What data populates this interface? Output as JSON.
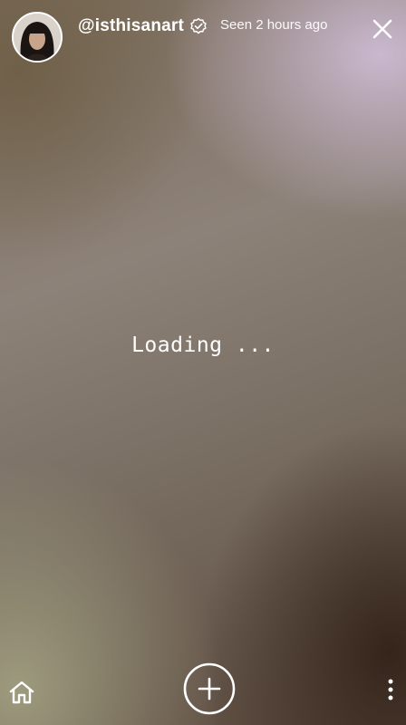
{
  "header": {
    "username": "@isthisanart",
    "verified": true,
    "seen_text": "Seen 2 hours ago",
    "avatar_icon": "user-avatar",
    "close_icon": "close-icon"
  },
  "content": {
    "loading_text": "Loading ..."
  },
  "bottom_bar": {
    "home_icon": "home-icon",
    "add_icon": "plus-circle-icon",
    "more_icon": "vertical-dots-icon"
  },
  "colors": {
    "foreground": "#ffffff",
    "bg_top_right": "#cdbcd4",
    "bg_bottom_right": "#322218",
    "bg_bottom_left": "#a09e80"
  }
}
